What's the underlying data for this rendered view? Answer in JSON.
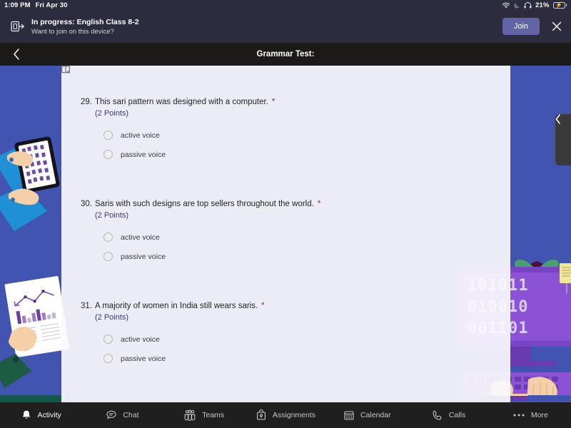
{
  "statusbar": {
    "time": "1:09 PM",
    "date": "Fri Apr 30",
    "battery_percent": "21%",
    "icons": [
      "wifi-icon",
      "moon-icon",
      "headphones-icon",
      "battery-charging-icon"
    ]
  },
  "banner": {
    "icon": "cast-device-icon",
    "title": "In progress: English Class 8-2",
    "subtitle": "Want to join on this device?",
    "join_label": "Join",
    "close_icon": "close-icon",
    "accent_color": "#6264a7"
  },
  "header": {
    "back_icon": "chevron-left-icon",
    "title": "Grammar Test:"
  },
  "drawer": {
    "handle_icon": "chevron-left-icon"
  },
  "form": {
    "required_mark": "*",
    "points_label": "(2 Points)",
    "reader_icon": "immersive-reader-icon",
    "questions": [
      {
        "number": "29.",
        "text": "This sari pattern was designed with a computer.",
        "points": "(2 Points)",
        "options": [
          "active voice",
          "passive voice"
        ]
      },
      {
        "number": "30.",
        "text": "Saris with such designs are top sellers throughout the world.",
        "points": "(2 Points)",
        "options": [
          "active voice",
          "passive voice"
        ]
      },
      {
        "number": "31.",
        "text": "A majority of women in India still wears saris.",
        "points": "(2 Points)",
        "options": [
          "active voice",
          "passive voice"
        ]
      }
    ]
  },
  "bottomnav": {
    "items": [
      {
        "label": "Activity",
        "icon": "bell-icon",
        "active": true
      },
      {
        "label": "Chat",
        "icon": "chat-icon",
        "active": false
      },
      {
        "label": "Teams",
        "icon": "teams-icon",
        "active": false
      },
      {
        "label": "Assignments",
        "icon": "assignments-icon",
        "active": false
      },
      {
        "label": "Calendar",
        "icon": "calendar-icon",
        "active": false
      },
      {
        "label": "Calls",
        "icon": "phone-icon",
        "active": false
      },
      {
        "label": "More",
        "icon": "ellipsis-icon",
        "active": false
      }
    ]
  },
  "theme": {
    "wallpaper_blue": "#4154b0",
    "teams_purple": "#6264a7",
    "panel_bg": "#fafafc",
    "header_dark": "#1b1a19",
    "banner_dark": "#2d2c3f"
  }
}
